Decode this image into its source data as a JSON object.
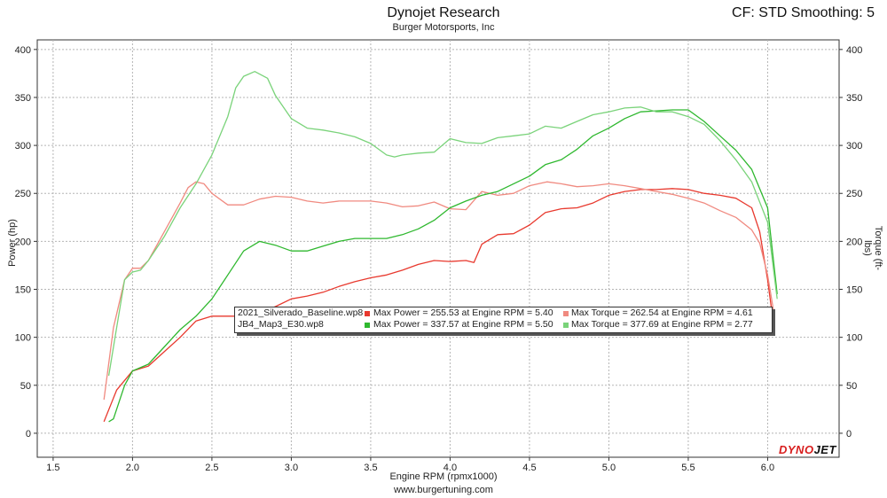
{
  "header": {
    "title": "Dynojet Research",
    "subtitle": "Burger Motorsports, Inc",
    "cf_text": "CF: STD Smoothing: 5"
  },
  "footer": {
    "url": "www.burgertuning.com"
  },
  "logo": {
    "text_red": "DYNO",
    "text_black": "JET"
  },
  "colors": {
    "baseline_power": "#e8392e",
    "baseline_torque": "#f08a80",
    "jb4_power": "#2fb82f",
    "jb4_torque": "#7ad37a"
  },
  "legend": {
    "rows": [
      {
        "file": "2021_Silverado_Baseline.wp8",
        "power": "Max Power = 255.53 at Engine RPM = 5.40",
        "torque": "Max Torque = 262.54 at Engine RPM = 4.61"
      },
      {
        "file": "JB4_Map3_E30.wp8",
        "power": "Max Power = 337.57 at Engine RPM = 5.50",
        "torque": "Max Torque = 377.69 at Engine RPM = 2.77"
      }
    ]
  },
  "chart_data": {
    "type": "line",
    "xlabel": "Engine RPM (rpmx1000)",
    "ylabel": "Power (hp)",
    "y2label": "Torque (ft-lbs)",
    "xlim": [
      1.4,
      6.45
    ],
    "ylim": [
      -25,
      410
    ],
    "xticks": [
      "1.5",
      "2.0",
      "2.5",
      "3.0",
      "3.5",
      "4.0",
      "4.5",
      "5.0",
      "5.5",
      "6.0"
    ],
    "yticks": [
      "0",
      "50",
      "100",
      "150",
      "200",
      "250",
      "300",
      "350",
      "400"
    ],
    "grid": true,
    "series": [
      {
        "name": "2021_Silverado_Baseline.wp8 Power",
        "key": "baseline_power",
        "x": [
          1.82,
          1.9,
          2.0,
          2.1,
          2.2,
          2.3,
          2.4,
          2.5,
          2.6,
          2.7,
          2.8,
          2.9,
          3.0,
          3.1,
          3.2,
          3.3,
          3.4,
          3.5,
          3.6,
          3.7,
          3.8,
          3.9,
          4.0,
          4.1,
          4.15,
          4.2,
          4.3,
          4.4,
          4.5,
          4.6,
          4.7,
          4.8,
          4.9,
          5.0,
          5.1,
          5.2,
          5.3,
          5.4,
          5.5,
          5.6,
          5.7,
          5.8,
          5.9,
          5.95,
          6.0,
          6.04
        ],
        "y": [
          12,
          45,
          65,
          70,
          85,
          100,
          117,
          122,
          122,
          122,
          125,
          132,
          140,
          143,
          147,
          153,
          158,
          162,
          165,
          170,
          176,
          180,
          179,
          180,
          178,
          197,
          207,
          208,
          217,
          230,
          234,
          235,
          240,
          248,
          252,
          254,
          254,
          255,
          254,
          250,
          248,
          245,
          235,
          210,
          160,
          110
        ]
      },
      {
        "name": "2021_Silverado_Baseline.wp8 Torque",
        "key": "baseline_torque",
        "x": [
          1.82,
          1.88,
          1.95,
          2.0,
          2.05,
          2.1,
          2.2,
          2.3,
          2.35,
          2.4,
          2.45,
          2.5,
          2.6,
          2.7,
          2.8,
          2.9,
          3.0,
          3.1,
          3.2,
          3.3,
          3.4,
          3.5,
          3.6,
          3.7,
          3.8,
          3.9,
          4.0,
          4.1,
          4.2,
          4.3,
          4.4,
          4.5,
          4.61,
          4.7,
          4.8,
          4.9,
          5.0,
          5.1,
          5.2,
          5.3,
          5.4,
          5.5,
          5.6,
          5.7,
          5.8,
          5.9,
          5.95,
          6.0,
          6.04
        ],
        "y": [
          35,
          110,
          160,
          172,
          172,
          180,
          210,
          240,
          256,
          262,
          260,
          250,
          238,
          238,
          244,
          247,
          246,
          242,
          240,
          242,
          242,
          242,
          240,
          236,
          237,
          241,
          234,
          233,
          252,
          248,
          250,
          258,
          262,
          260,
          257,
          258,
          260,
          258,
          255,
          252,
          249,
          245,
          240,
          232,
          225,
          212,
          198,
          165,
          125
        ]
      },
      {
        "name": "JB4_Map3_E30.wp8 Power",
        "key": "jb4_power",
        "x": [
          1.85,
          1.88,
          1.95,
          2.0,
          2.1,
          2.2,
          2.3,
          2.4,
          2.5,
          2.6,
          2.7,
          2.8,
          2.9,
          3.0,
          3.1,
          3.2,
          3.3,
          3.4,
          3.5,
          3.6,
          3.7,
          3.8,
          3.9,
          4.0,
          4.1,
          4.2,
          4.3,
          4.4,
          4.5,
          4.6,
          4.7,
          4.8,
          4.9,
          5.0,
          5.1,
          5.2,
          5.3,
          5.4,
          5.5,
          5.6,
          5.7,
          5.8,
          5.9,
          6.0,
          6.06
        ],
        "y": [
          12,
          15,
          50,
          65,
          72,
          90,
          108,
          122,
          140,
          165,
          190,
          200,
          196,
          190,
          190,
          195,
          200,
          203,
          203,
          203,
          207,
          213,
          222,
          235,
          242,
          248,
          252,
          260,
          268,
          280,
          285,
          296,
          310,
          318,
          328,
          335,
          336,
          337,
          337,
          325,
          310,
          295,
          275,
          235,
          145
        ]
      },
      {
        "name": "JB4_Map3_E30.wp8 Torque",
        "key": "jb4_torque",
        "x": [
          1.85,
          1.9,
          1.95,
          2.0,
          2.05,
          2.1,
          2.2,
          2.3,
          2.4,
          2.5,
          2.6,
          2.65,
          2.7,
          2.77,
          2.85,
          2.9,
          3.0,
          3.1,
          3.2,
          3.3,
          3.4,
          3.5,
          3.6,
          3.65,
          3.7,
          3.8,
          3.9,
          4.0,
          4.1,
          4.2,
          4.3,
          4.4,
          4.5,
          4.6,
          4.7,
          4.8,
          4.9,
          5.0,
          5.1,
          5.2,
          5.3,
          5.4,
          5.5,
          5.6,
          5.7,
          5.8,
          5.9,
          6.0,
          6.06
        ],
        "y": [
          60,
          110,
          160,
          168,
          170,
          180,
          205,
          235,
          260,
          290,
          330,
          360,
          372,
          377,
          370,
          352,
          328,
          318,
          316,
          313,
          309,
          302,
          290,
          288,
          290,
          292,
          293,
          307,
          303,
          302,
          308,
          310,
          312,
          320,
          318,
          325,
          332,
          335,
          339,
          340,
          335,
          335,
          330,
          322,
          305,
          285,
          262,
          220,
          140
        ]
      }
    ]
  }
}
